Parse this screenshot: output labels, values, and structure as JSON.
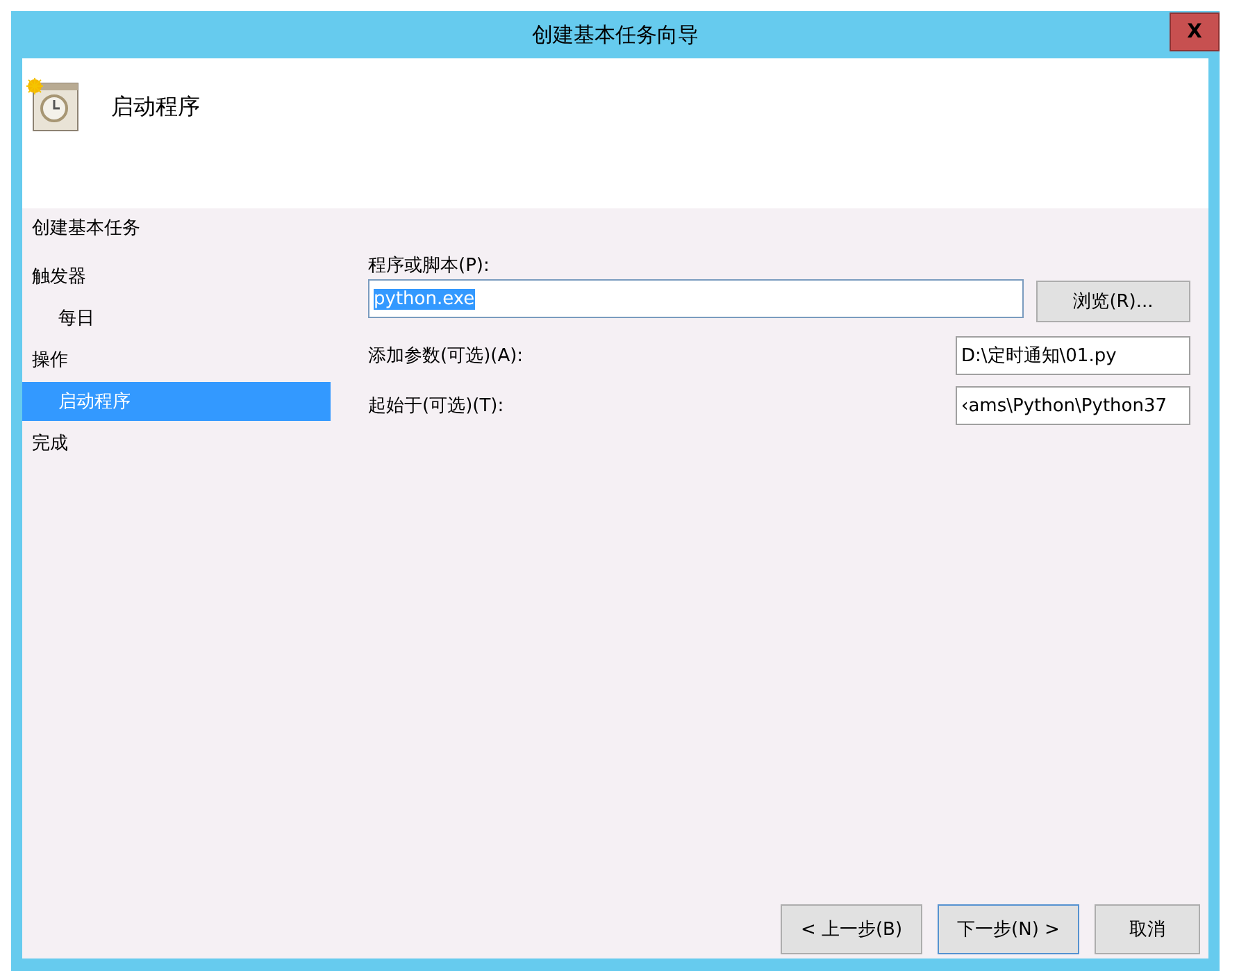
{
  "window": {
    "title": "创建基本任务向导",
    "close": "X"
  },
  "header": {
    "title": "启动程序"
  },
  "nav": {
    "title": "创建基本任务",
    "items": [
      {
        "label": "触发器",
        "selected": false,
        "children": [
          {
            "label": "每日",
            "selected": false
          }
        ]
      },
      {
        "label": "操作",
        "selected": false,
        "children": [
          {
            "label": "启动程序",
            "selected": true
          }
        ]
      },
      {
        "label": "完成",
        "selected": false
      }
    ]
  },
  "form": {
    "program": {
      "label": "程序或脚本(P):",
      "value": "python.exe",
      "selected": true,
      "browse": "浏览(R)..."
    },
    "fields": [
      {
        "label": "添加参数(可选)(A):",
        "value": "D:\\定时通知\\01.py"
      },
      {
        "label": "起始于(可选)(T):",
        "value": "‹ams\\Python\\Python37"
      }
    ]
  },
  "buttons": [
    {
      "label": "< 上一步(B)",
      "focused": false
    },
    {
      "label": "下一步(N) >",
      "focused": true
    },
    {
      "label": "取消",
      "focused": false
    }
  ]
}
